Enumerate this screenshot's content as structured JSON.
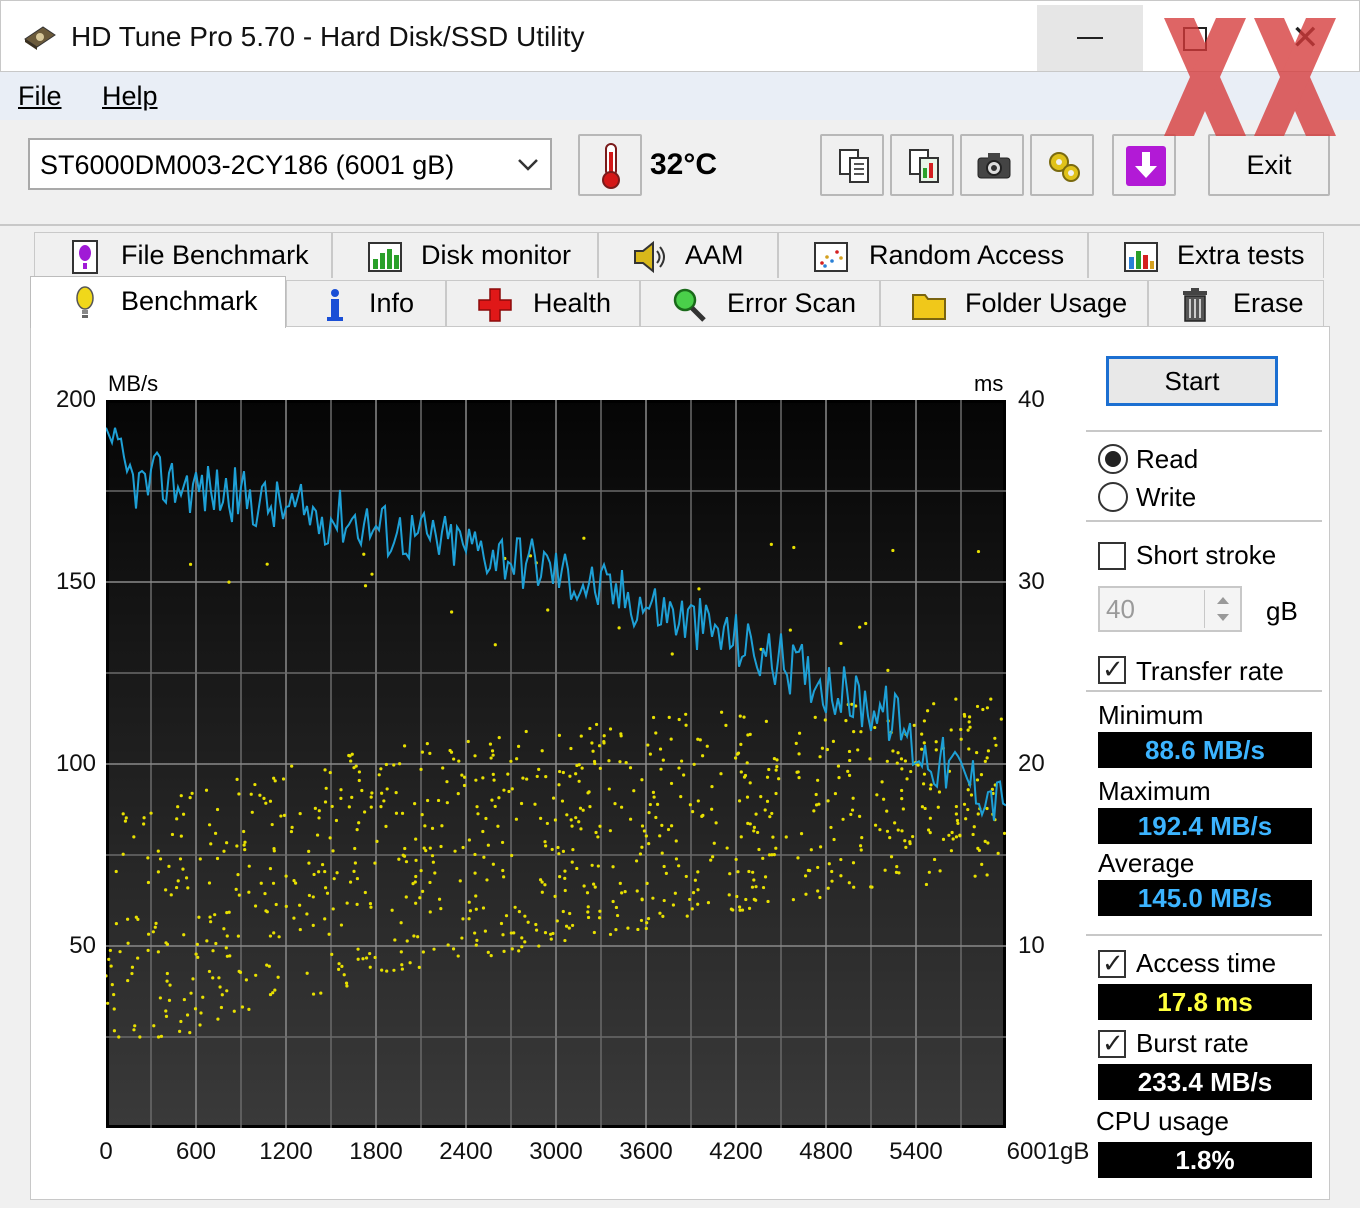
{
  "window": {
    "title": "HD Tune Pro 5.70 - Hard Disk/SSD Utility",
    "controls": {
      "minimize": "minimize-icon",
      "maximize": "maximize-icon",
      "close": "close-icon"
    }
  },
  "menu": {
    "items": [
      {
        "label": "File",
        "mnemonic": "F"
      },
      {
        "label": "Help",
        "mnemonic": "H"
      }
    ]
  },
  "toolbar": {
    "drive": "ST6000DM003-2CY186 (6001 gB)",
    "temperature": "32°C",
    "icons": [
      "copy-info-icon",
      "copy-all-icon",
      "screenshot-icon",
      "options-icon",
      "save-down-icon"
    ],
    "exit_label": "Exit"
  },
  "tabs": {
    "top_row": [
      {
        "label": "File Benchmark",
        "icon": "file-benchmark-icon"
      },
      {
        "label": "Disk monitor",
        "icon": "disk-monitor-icon"
      },
      {
        "label": "AAM",
        "icon": "aam-speaker-icon"
      },
      {
        "label": "Random Access",
        "icon": "random-access-icon"
      },
      {
        "label": "Extra tests",
        "icon": "extra-tests-icon"
      }
    ],
    "bottom_row": [
      {
        "label": "Benchmark",
        "icon": "benchmark-icon",
        "active": true
      },
      {
        "label": "Info",
        "icon": "info-icon"
      },
      {
        "label": "Health",
        "icon": "health-cross-icon"
      },
      {
        "label": "Error Scan",
        "icon": "error-scan-magnifier-icon"
      },
      {
        "label": "Folder Usage",
        "icon": "folder-icon"
      },
      {
        "label": "Erase",
        "icon": "erase-trash-icon"
      }
    ]
  },
  "chart_data": {
    "type": "line",
    "left_axis_label": "MB/s",
    "right_axis_label": "ms",
    "x_unit": "gB",
    "xlim": [
      0,
      6001
    ],
    "ylim_left": [
      0,
      200
    ],
    "ylim_right": [
      0,
      40
    ],
    "x_ticks": [
      "0",
      "600",
      "1200",
      "1800",
      "2400",
      "3000",
      "3600",
      "4200",
      "4800",
      "5400",
      "6001gB"
    ],
    "left_ticks": [
      "200",
      "150",
      "100",
      "50"
    ],
    "right_ticks": [
      "40",
      "30",
      "20",
      "10"
    ],
    "grid": true,
    "series": [
      {
        "role": "transfer-rate",
        "color": "#1ea0d6",
        "axis": "left",
        "x": [
          0,
          120,
          240,
          360,
          480,
          600,
          720,
          840,
          960,
          1080,
          1200,
          1320,
          1440,
          1560,
          1680,
          1800,
          1920,
          2040,
          2160,
          2280,
          2400,
          2520,
          2640,
          2760,
          2880,
          3000,
          3120,
          3240,
          3360,
          3480,
          3600,
          3720,
          3840,
          3960,
          4080,
          4200,
          4320,
          4440,
          4560,
          4680,
          4800,
          4920,
          5040,
          5160,
          5280,
          5400,
          5520,
          5640,
          5760,
          5880,
          6001
        ],
        "values": [
          192.4,
          180,
          176,
          178,
          177,
          176,
          175,
          174,
          173,
          171,
          170,
          169,
          168,
          168,
          167,
          165,
          164,
          163,
          162,
          161,
          160,
          159,
          158,
          156,
          155,
          153,
          151,
          149,
          147,
          146,
          144,
          142,
          140,
          138,
          136,
          134,
          131,
          129,
          127,
          125,
          122,
          119,
          117,
          115,
          112,
          104,
          101,
          99,
          96,
          92,
          88.6
        ]
      },
      {
        "role": "access-time",
        "type": "scatter",
        "color": "#e8e000",
        "axis": "right",
        "note_range_ms": [
          5,
          33
        ]
      }
    ]
  },
  "benchmark_panel": {
    "start_label": "Start",
    "read_label": "Read",
    "write_label": "Write",
    "mode_selected": "Read",
    "short_stroke_label": "Short stroke",
    "short_stroke_checked": false,
    "short_stroke_value": "40",
    "short_stroke_unit": "gB",
    "transfer_rate_label": "Transfer rate",
    "transfer_rate_checked": true,
    "minimum_label": "Minimum",
    "minimum_value": "88.6 MB/s",
    "maximum_label": "Maximum",
    "maximum_value": "192.4 MB/s",
    "average_label": "Average",
    "average_value": "145.0 MB/s",
    "access_time_label": "Access time",
    "access_time_checked": true,
    "access_time_value": "17.8 ms",
    "burst_rate_label": "Burst rate",
    "burst_rate_checked": true,
    "burst_rate_value": "233.4 MB/s",
    "cpu_usage_label": "CPU usage",
    "cpu_usage_value": "1.8%"
  },
  "colors": {
    "transfer_line": "#1ea0d6",
    "access_points": "#e8e000",
    "value_text_blue": "#3cb4ff",
    "value_text_yellow": "#ffff3c",
    "value_text_white": "#ffffff",
    "start_border": "#1c6fd1"
  }
}
